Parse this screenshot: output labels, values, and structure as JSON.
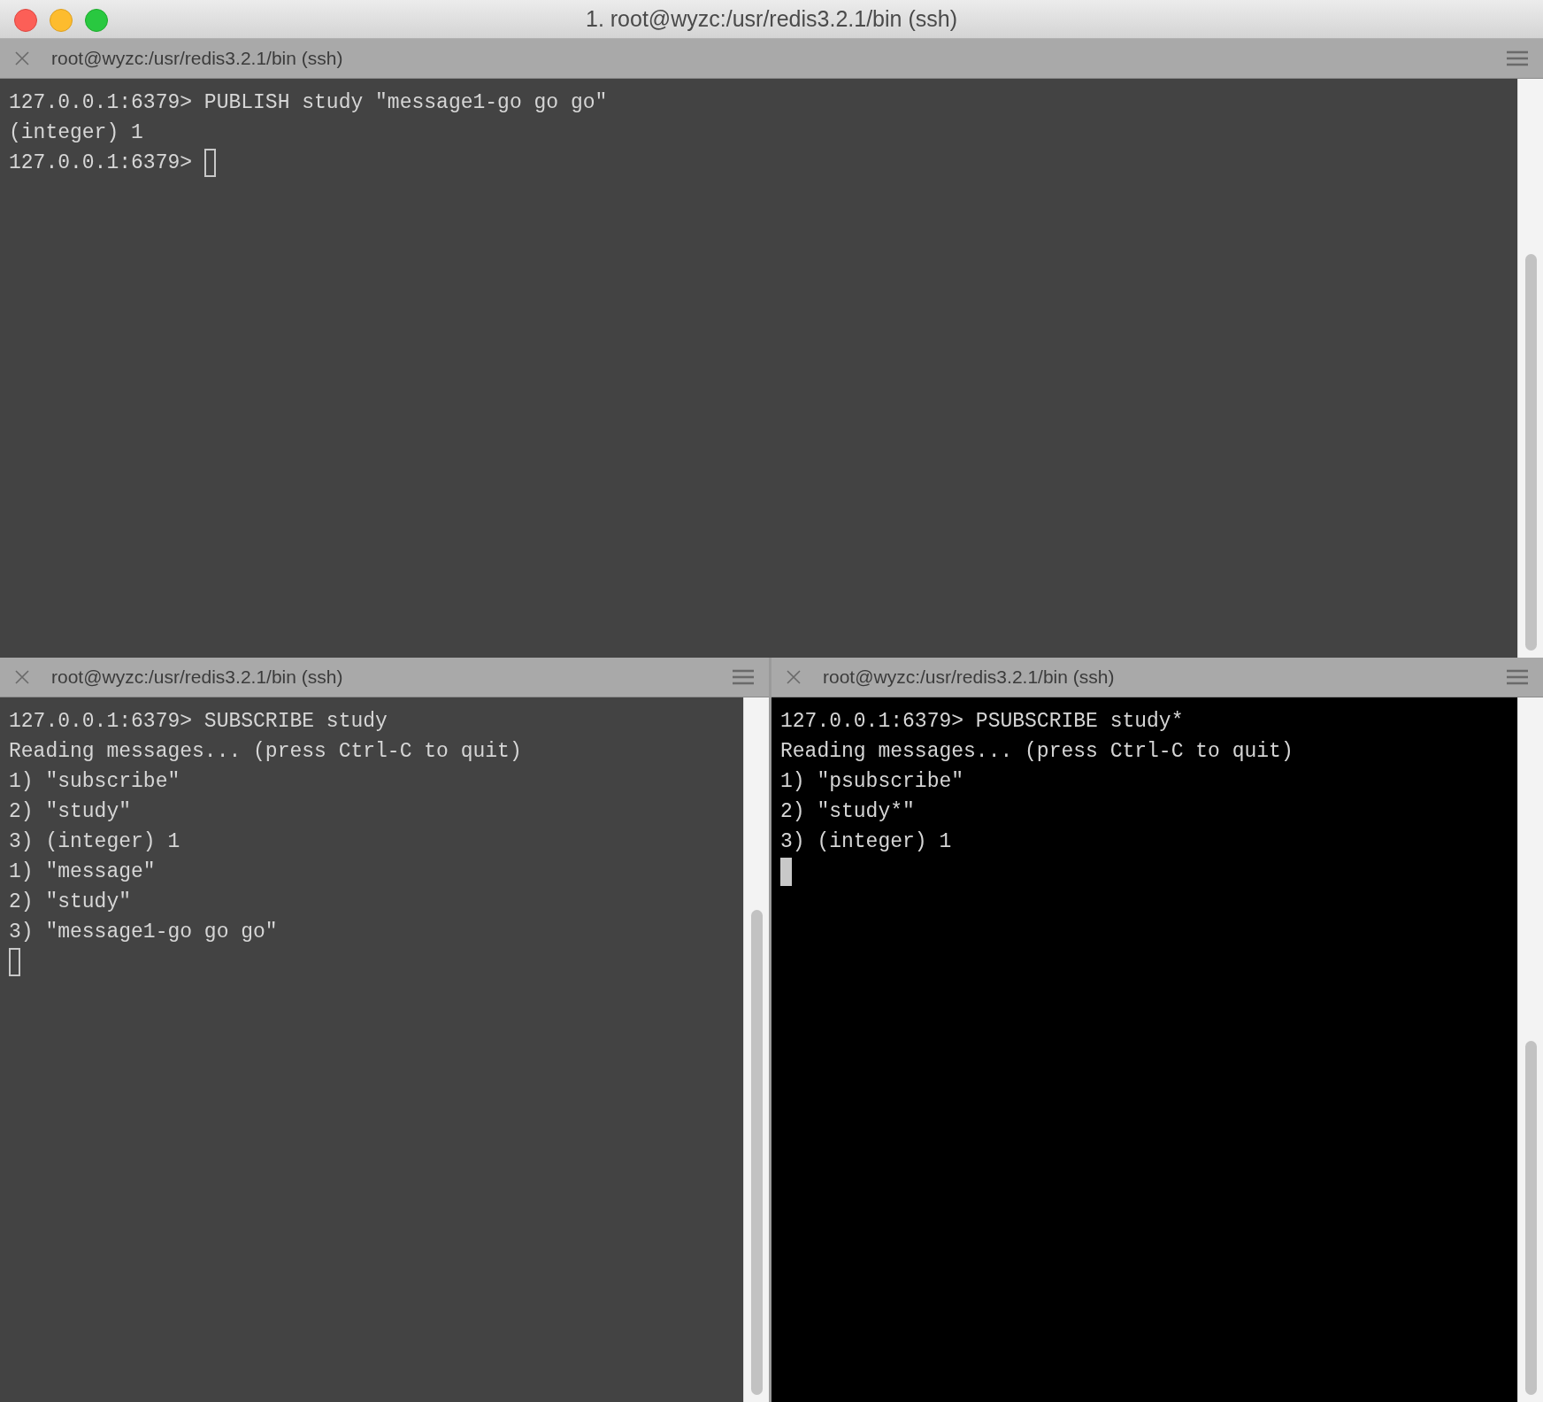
{
  "window": {
    "title": "1. root@wyzc:/usr/redis3.2.1/bin (ssh)"
  },
  "panes": [
    {
      "title": "root@wyzc:/usr/redis3.2.1/bin (ssh)",
      "active": false,
      "lines": [
        "127.0.0.1:6379> PUBLISH study \"message1-go go go\"",
        "(integer) 1"
      ],
      "prompt": "127.0.0.1:6379>"
    },
    {
      "title": "root@wyzc:/usr/redis3.2.1/bin (ssh)",
      "active": false,
      "lines": [
        "127.0.0.1:6379> SUBSCRIBE study",
        "Reading messages... (press Ctrl-C to quit)",
        "1) \"subscribe\"",
        "2) \"study\"",
        "3) (integer) 1",
        "1) \"message\"",
        "2) \"study\"",
        "3) \"message1-go go go\""
      ]
    },
    {
      "title": "root@wyzc:/usr/redis3.2.1/bin (ssh)",
      "active": true,
      "lines": [
        "127.0.0.1:6379> PSUBSCRIBE study*",
        "Reading messages... (press Ctrl-C to quit)",
        "1) \"psubscribe\"",
        "2) \"study*\"",
        "3) (integer) 1"
      ]
    }
  ]
}
